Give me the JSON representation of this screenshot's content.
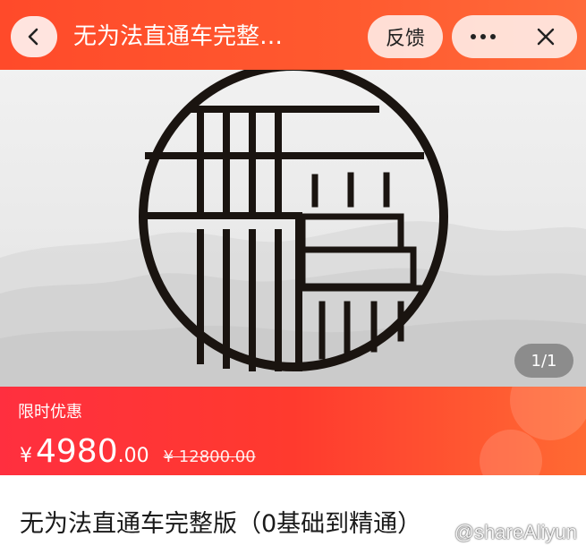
{
  "header": {
    "title": "无为法直通车完整…",
    "feedback_label": "反馈"
  },
  "icons": {
    "back": "chevron-left-icon",
    "more": "more-dots-icon",
    "close": "close-icon"
  },
  "banner": {
    "page_indicator": "1/1"
  },
  "price": {
    "promo_label": "限时优惠",
    "currency": "¥",
    "amount_integer": "4980",
    "amount_decimal": ".00",
    "original_price": "¥ 12800.00"
  },
  "product": {
    "title": "无为法直通车完整版（0基础到精通）"
  },
  "watermark": "@shareAliyun",
  "colors": {
    "header_orange": "#ff5a2f",
    "price_red": "#ff2f3f",
    "logo_black": "#1a1410"
  }
}
